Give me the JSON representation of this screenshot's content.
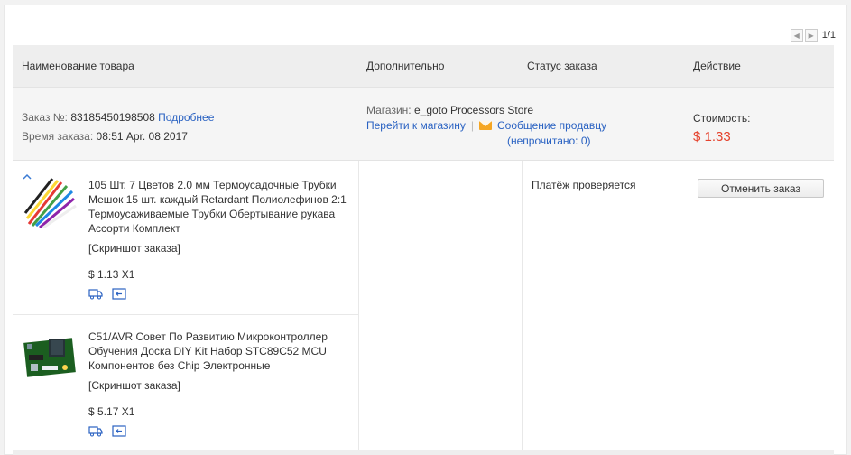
{
  "pagination": {
    "text": "1/1"
  },
  "table_header": {
    "name": "Наименование товара",
    "extra": "Дополнительно",
    "status": "Статус заказа",
    "action": "Действие"
  },
  "order": {
    "number_label": "Заказ №:",
    "number": "83185450198508",
    "details_link": "Подробнее",
    "time_label": "Время заказа:",
    "time": "08:51 Apr. 08 2017",
    "store_label": "Магазин:",
    "store_name": "e_goto Processors Store",
    "store_link": "Перейти к магазину",
    "message_link": "Сообщение продавцу",
    "unread_prefix": "(непрочитано: ",
    "unread_count": "0",
    "unread_suffix": ")",
    "cost_label": "Стоимость:",
    "cost": "$ 1.33",
    "status": "Платёж проверяется",
    "cancel_button": "Отменить заказ"
  },
  "items": [
    {
      "title": "105 Шт. 7 Цветов 2.0 мм Термоусадочные Трубки Мешок 15 шт. каждый Retardant Полиолефинов 2:1 Термоусаживаемые Трубки Обертывание рукава Ассорти Комплект",
      "screenshot_link": "[Скриншот заказа]",
      "price_qty": "$ 1.13 X1"
    },
    {
      "title": "C51/AVR Совет По Развитию Микроконтроллер Обучения Доска DIY Kit Набор STC89C52 MCU Компонентов без Chip Электронные",
      "screenshot_link": "[Скриншот заказа]",
      "price_qty": "$ 5.17 X1"
    }
  ],
  "colors": {
    "link": "#2a62c2",
    "price": "#e5432e",
    "header_bg": "#eeeeee"
  }
}
